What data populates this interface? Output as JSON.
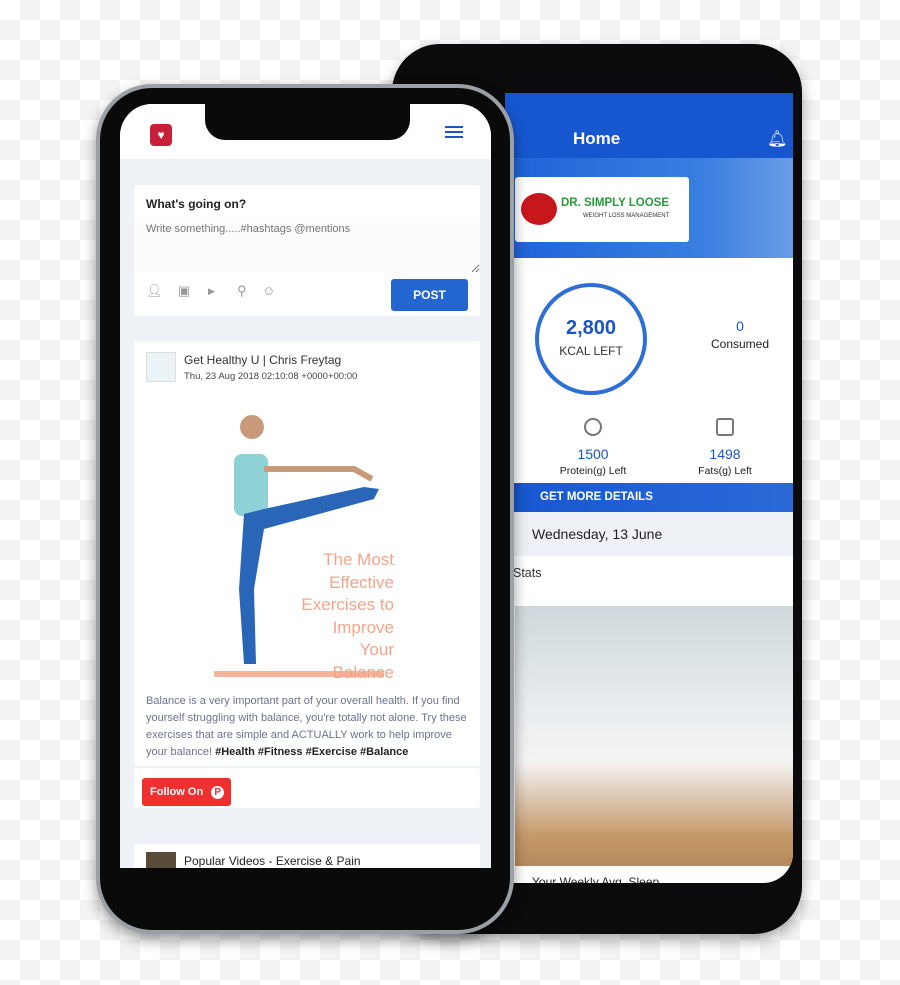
{
  "right_app": {
    "header": {
      "title": "Home",
      "bell_icon": "bell-icon"
    },
    "brand": {
      "name": "DR. SIMPLY LOOSE",
      "tagline": "WEIGHT LOSS MANAGEMENT"
    },
    "calories": {
      "value": "2,800",
      "label": "KCAL LEFT",
      "consumed_value": "0",
      "consumed_label": "Consumed"
    },
    "macros": [
      {
        "value": "1500",
        "label": "Protein(g) Left",
        "icon": "protein-icon"
      },
      {
        "value": "1498",
        "label": "Fats(g) Left",
        "icon": "fats-icon"
      }
    ],
    "details_label": "GET MORE DETAILS",
    "date": "Wednesday, 13 June",
    "stats_label": "Stats",
    "weekly_label": "Your Weekly Avg. Sleep",
    "accent": "#1657d0"
  },
  "left_app": {
    "composer": {
      "title": "What's going on?",
      "placeholder": "Write something.....#hashtags @mentions",
      "icons": [
        "tag-friend-icon",
        "photo-icon",
        "youtube-icon",
        "location-icon",
        "emoji-icon"
      ],
      "post_label": "POST"
    },
    "post": {
      "author": "Get Healthy U | Chris Freytag",
      "timestamp": "Thu, 23 Aug 2018 02:10:08 +0000+00:00",
      "image_text": "The Most Effective Exercises to Improve Your Balance",
      "body": "Balance is a very important part of your overall health. If you find yourself struggling with balance, you're totally not alone. Try these exercises that are simple and ACTUALLY work to help improve your balance!",
      "hashtags": "#Health #Fitness #Exercise #Balance",
      "follow_label": "Follow On"
    },
    "next_post": {
      "title": "Popular Videos - Exercise & Pain"
    },
    "accent": "#2466d1"
  }
}
